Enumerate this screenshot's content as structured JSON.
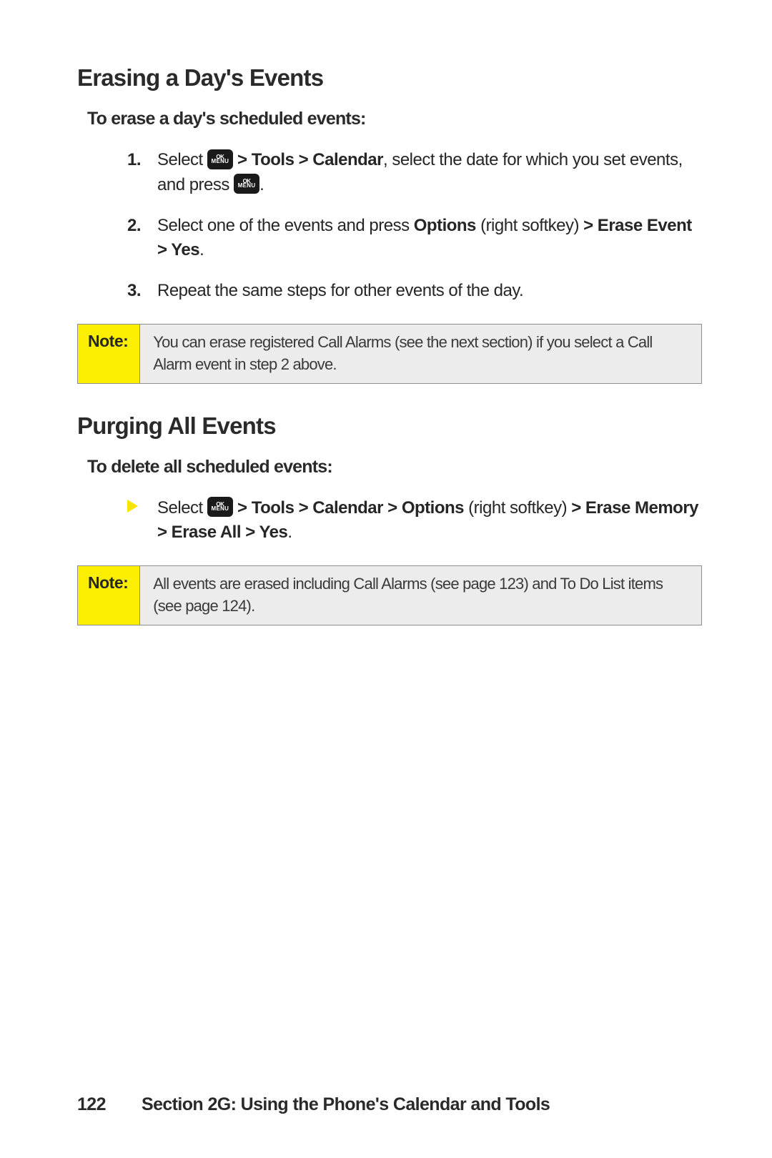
{
  "section1": {
    "heading": "Erasing a Day's Events",
    "subheading": "To erase a day's scheduled events:",
    "steps": {
      "s1_num": "1.",
      "s1_a": "Select ",
      "s1_b": " > Tools > Calendar",
      "s1_c": ", select the date for which you set events, and press ",
      "s1_d": ".",
      "s2_num": "2.",
      "s2_a": "Select one of the events and press ",
      "s2_b": "Options",
      "s2_c": " (right softkey) ",
      "s2_d": "> Erase Event > Yes",
      "s2_e": ".",
      "s3_num": "3.",
      "s3_a": "Repeat the same steps for other events of the day."
    },
    "note_label": "Note:",
    "note_body": "You can erase registered Call Alarms (see the next section) if you select a Call Alarm event in step 2 above."
  },
  "section2": {
    "heading": "Purging All Events",
    "subheading": "To delete all scheduled events:",
    "bullet": {
      "a": "Select ",
      "b": " > Tools > Calendar > Options",
      "c": " (right softkey) ",
      "d": "> Erase Memory > Erase All > Yes",
      "e": "."
    },
    "note_label": "Note:",
    "note_body": "All events are erased including Call Alarms (see page 123) and To Do List items (see page 124)."
  },
  "footer": {
    "page": "122",
    "title": "Section 2G: Using the Phone's Calendar and Tools"
  }
}
